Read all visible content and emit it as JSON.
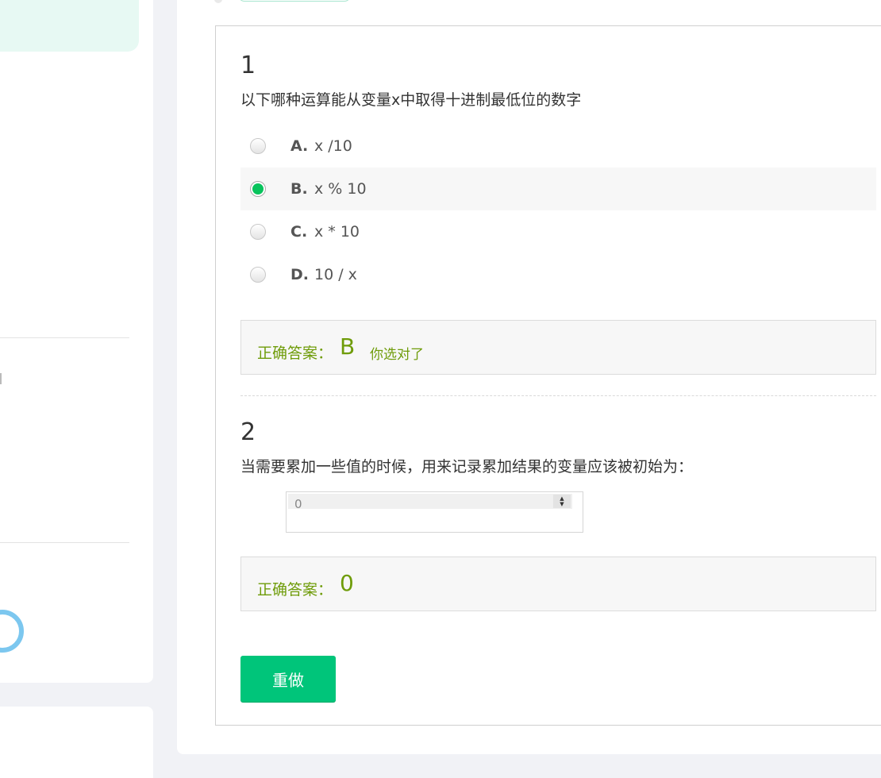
{
  "questions": [
    {
      "number": "1",
      "text": "以下哪种运算能从变量x中取得十进制最低位的数字",
      "options": [
        {
          "letter": "A.",
          "text": "x /10",
          "selected": false
        },
        {
          "letter": "B.",
          "text": "x % 10",
          "selected": true
        },
        {
          "letter": "C.",
          "text": "x * 10",
          "selected": false
        },
        {
          "letter": "D.",
          "text": "10 / x",
          "selected": false
        }
      ],
      "answer_label": "正确答案：",
      "answer_value": "B",
      "answer_note": "你选对了"
    },
    {
      "number": "2",
      "text": "当需要累加一些值的时候，用来记录累加结果的变量应该被初始为：",
      "input_value": "0",
      "answer_label": "正确答案：",
      "answer_value": "0"
    }
  ],
  "redo_label": "重做",
  "colors": {
    "accent": "#00c57a",
    "correct": "#6f9c0a",
    "radio_checked": "#08c35c"
  }
}
